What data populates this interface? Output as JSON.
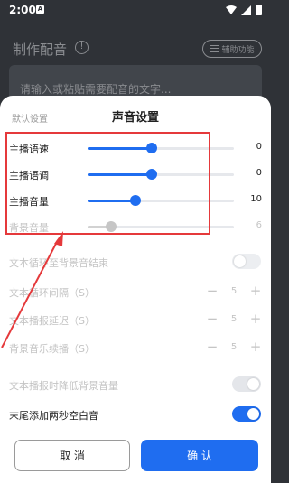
{
  "status_bar": {
    "time": "2:00",
    "notification_glyph": "A"
  },
  "page": {
    "title": "制作配音",
    "info_glyph": "!",
    "assist_button": "辅助功能",
    "text_placeholder": "请输入或粘贴需要配音的文字..."
  },
  "sheet": {
    "title": "声音设置",
    "reset_label": "默认设置",
    "sliders": [
      {
        "label": "主播语速",
        "value": "0",
        "fraction": 0.44,
        "enabled": true
      },
      {
        "label": "主播语调",
        "value": "0",
        "fraction": 0.44,
        "enabled": true
      },
      {
        "label": "主播音量",
        "value": "10",
        "fraction": 0.33,
        "enabled": true
      },
      {
        "label": "背景音量",
        "value": "6",
        "fraction": 0.16,
        "enabled": false
      }
    ],
    "toggles": [
      {
        "label": "文本循环至背景音结束",
        "on": false,
        "enabled": false
      },
      {
        "label": "文本播报时降低背景音量",
        "on": true,
        "enabled": false
      },
      {
        "label": "末尾添加两秒空白音",
        "on": true,
        "enabled": true
      }
    ],
    "steppers": [
      {
        "label": "文本循环间隔（S）",
        "value": "5",
        "minus": "−",
        "plus": "+"
      },
      {
        "label": "文本播报延迟（S）",
        "value": "5",
        "minus": "−",
        "plus": "+"
      },
      {
        "label": "背景音乐续播（S）",
        "value": "5",
        "minus": "−",
        "plus": "+"
      }
    ],
    "cancel_label": "取 消",
    "confirm_label": "确 认"
  },
  "colors": {
    "accent": "#1f6df0",
    "annotation": "#e5393b",
    "overlay": "#2f3237"
  }
}
